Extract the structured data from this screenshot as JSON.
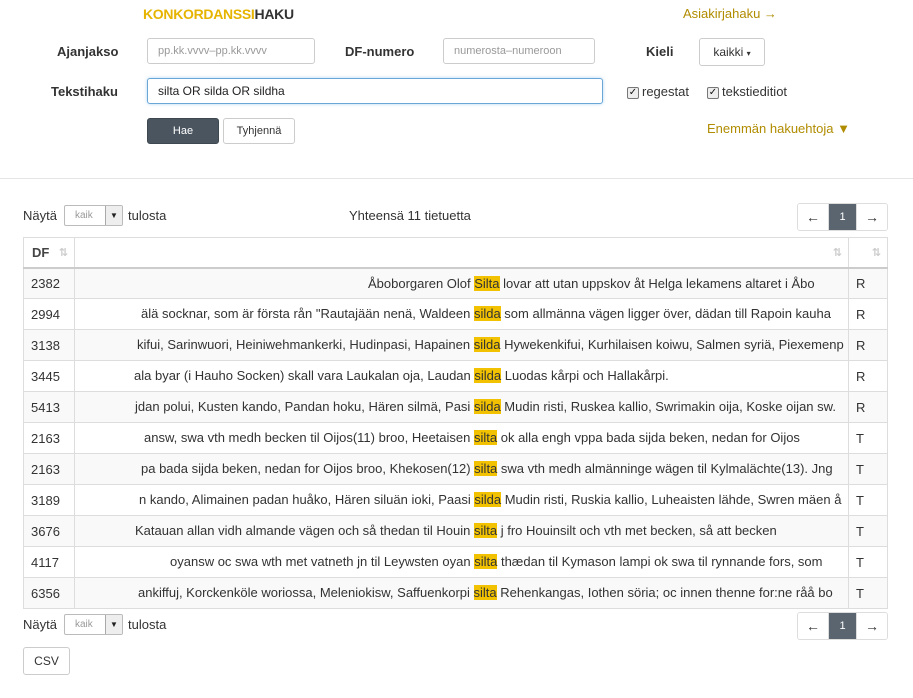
{
  "header": {
    "logo_a": "KONKORDANSSI",
    "logo_b": "HAKU",
    "doc_search_link": "Asiakirjahaku →"
  },
  "form": {
    "period_label": "Ajanjakso",
    "period_placeholder": "pp.kk.vvvv–pp.kk.vvvv",
    "df_label": "DF-numero",
    "df_placeholder": "numerosta–numeroon",
    "lang_label": "Kieli",
    "lang_value": "kaikki",
    "text_label": "Tekstihaku",
    "text_value": "silta OR silda OR sildha",
    "cb_regestat": "regestat",
    "cb_editions": "tekstieditiot",
    "search_button": "Hae",
    "clear_button": "Tyhjennä",
    "more_options": "Enemmän hakuehtoja ▼"
  },
  "results": {
    "show_label": "Näytä",
    "show_value": "kaik",
    "per_page_suffix": "tulosta",
    "total": "Yhteensä 11 tietuetta",
    "page": "1",
    "col_df": "DF",
    "csv_button": "CSV",
    "rows": [
      {
        "df": "2382",
        "before": "Åboborgaren Olof ",
        "hit": "Silta",
        "after": " lovar att utan uppskov åt Helga lekamens altaret i Åbo",
        "type": "R"
      },
      {
        "df": "2994",
        "before": "älä socknar, som är första rån \"Rautajään nenä, Waldeen ",
        "hit": "silda",
        "after": " som allmänna vägen ligger över, dädan till Rapoin kauha",
        "type": "R"
      },
      {
        "df": "3138",
        "before": "kifui, Sarinwuori, Heiniwehmankerki, Hudinpasi, Hapainen ",
        "hit": "silda",
        "after": " Hywekenkifui, Kurhilaisen koiwu, Salmen syriä, Piexemenp",
        "type": "R"
      },
      {
        "df": "3445",
        "before": "ala byar (i Hauho Socken) skall vara Laukalan oja, Laudan ",
        "hit": "silda",
        "after": " Luodas kårpi och Hallakårpi.",
        "type": "R"
      },
      {
        "df": "5413",
        "before": "jdan polui, Kusten kando, Pandan hoku, Hären silmä, Pasi ",
        "hit": "silda",
        "after": " Mudin risti, Ruskea kallio, Swrimakin oija, Koske oijan sw.",
        "type": "R"
      },
      {
        "df": "2163",
        "before": "answ, swa vth medh becken til Oijos(11) broo, Heetaisen ",
        "hit": "silta",
        "after": " ok alla engh vppa bada sijda beken, nedan for Oijos",
        "type": "T"
      },
      {
        "df": "2163",
        "before": "pa bada sijda beken, nedan for Oijos broo, Khekosen(12) ",
        "hit": "silta",
        "after": " swa vth medh almänninge wägen til Kylmalächte(13). Jng",
        "type": "T"
      },
      {
        "df": "3189",
        "before": "n kando, Alimainen padan huåko, Hären siluän ioki, Paasi ",
        "hit": "silda",
        "after": " Mudin risti, Ruskia kallio, Luheaisten lähde, Swren mäen å",
        "type": "T"
      },
      {
        "df": "3676",
        "before": "Katauan allan vidh almande vägen och så thedan til Houin ",
        "hit": "silta",
        "after": " j fro Houinsilt och vth met becken, så att becken",
        "type": "T"
      },
      {
        "df": "4117",
        "before": "oyansw oc swa wth met vatneth jn til Leywsten oyan ",
        "hit": "silta",
        "after": " thædan til Kymason lampi ok swa til rynnande fors, som",
        "type": "T"
      },
      {
        "df": "6356",
        "before": "ankiffuj, Korckenköle woriossa, Meleniokisw, Saffuenkorpi ",
        "hit": "silta",
        "after": " Rehenkangas, Iothen söria; oc innen thenne for:ne råå bo",
        "type": "T"
      }
    ]
  }
}
